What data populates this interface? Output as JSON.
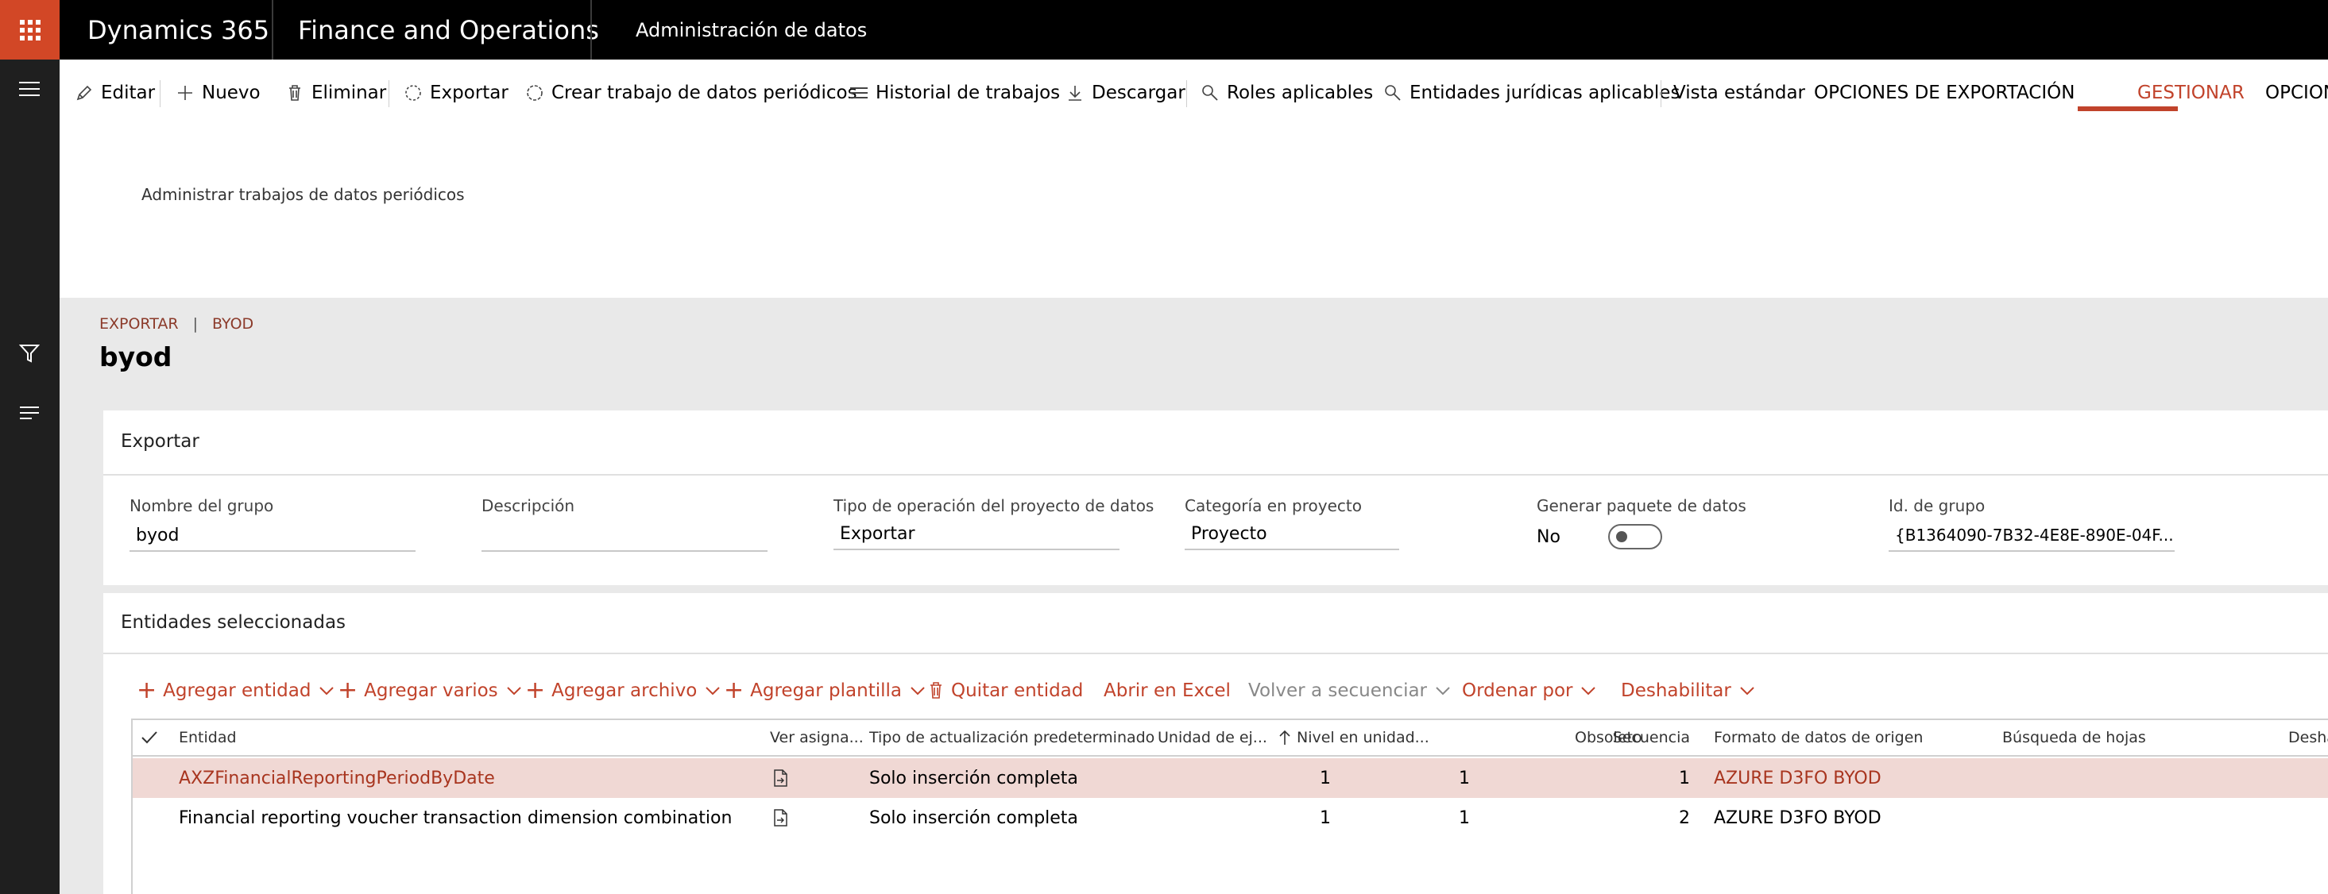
{
  "header": {
    "app_name": "Dynamics 365",
    "module_name": "Finance and Operations",
    "breadcrumb": "Administración de datos"
  },
  "toolbar": {
    "items": [
      {
        "label": "Editar",
        "icon": "pencil-icon"
      },
      {
        "label": "Nuevo",
        "icon": "plus-icon"
      },
      {
        "label": "Eliminar",
        "icon": "trash-icon"
      },
      {
        "label": "Exportar",
        "icon": "export-icon"
      },
      {
        "label": "Crear trabajo de datos periódicos",
        "icon": "recurring-icon"
      },
      {
        "label": "Historial de trabajos",
        "icon": "list-icon"
      },
      {
        "label": "Descargar",
        "icon": "download-icon"
      },
      {
        "label": "Roles aplicables",
        "icon": "search-icon"
      },
      {
        "label": "Entidades jurídicas aplicables",
        "icon": "search-icon"
      }
    ],
    "tabs": [
      {
        "label": "Vista estándar"
      },
      {
        "label": "OPCIONES DE EXPORTACIÓN"
      },
      {
        "label": "GESTIONAR",
        "active": true
      },
      {
        "label": "OPCIONES"
      }
    ],
    "subaction": "Administrar trabajos de datos periódicos"
  },
  "page": {
    "breadcrumb_1": "EXPORTAR",
    "breadcrumb_sep": "|",
    "breadcrumb_2": "BYOD",
    "title": "byod"
  },
  "export_section": {
    "header": "Exportar",
    "fields": {
      "group_name_label": "Nombre del grupo",
      "group_name_value": "byod",
      "description_label": "Descripción",
      "description_value": "",
      "operation_type_label": "Tipo de operación del proyecto de datos",
      "operation_type_value": "Exportar",
      "category_label": "Categoría en proyecto",
      "category_value": "Proyecto",
      "package_label": "Generar paquete de datos",
      "package_value": "No",
      "group_id_label": "Id. de grupo",
      "group_id_value": "{B1364090-7B32-4E8E-890E-04F..."
    }
  },
  "entities_section": {
    "header": "Entidades seleccionadas",
    "actions": {
      "add_entity": "Agregar entidad",
      "add_multiple": "Agregar varios",
      "add_file": "Agregar archivo",
      "add_template": "Agregar plantilla",
      "remove_entity": "Quitar entidad",
      "open_excel": "Abrir en Excel",
      "resequence": "Volver a secuenciar",
      "sort_by": "Ordenar por",
      "disable": "Deshabilitar"
    },
    "columns": {
      "entity": "Entidad",
      "view_mapping": "Ver asigna...",
      "default_update": "Tipo de actualización predeterminado",
      "execution_unit": "Unidad de ej...",
      "level": "Nivel en unidad...",
      "sequence": "Secuencia",
      "obsolete": "Obsoleto",
      "source_format": "Formato de datos de origen",
      "sheet_lookup": "Búsqueda de hojas",
      "disable_col": "Desha"
    },
    "rows": [
      {
        "entity": "AXZFinancialReportingPeriodByDate",
        "update_type": "Solo inserción completa",
        "unit": "1",
        "level": "1",
        "sequence": "1",
        "source_format": "AZURE D3FO BYOD"
      },
      {
        "entity": "Financial reporting voucher transaction dimension combination",
        "update_type": "Solo inserción completa",
        "unit": "1",
        "level": "1",
        "sequence": "2",
        "source_format": "AZURE D3FO BYOD"
      }
    ]
  },
  "colors": {
    "accent": "#c1432b",
    "waffle": "#d24726",
    "selected_row": "#f0d8d4"
  }
}
